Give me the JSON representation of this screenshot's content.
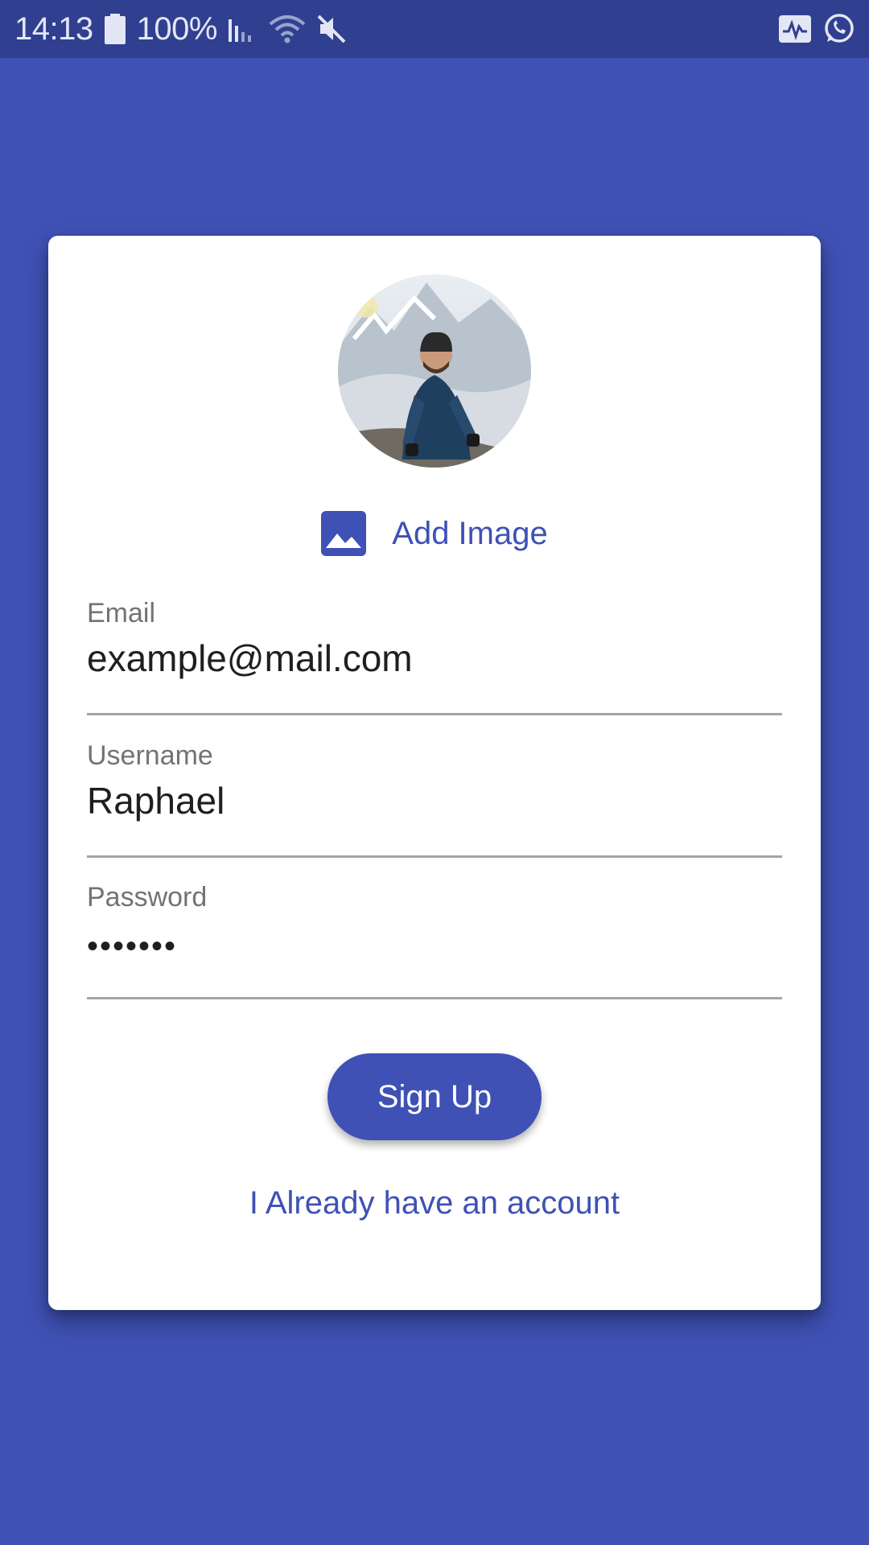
{
  "status_bar": {
    "time": "14:13",
    "battery_percent": "100%",
    "icons": [
      "battery-icon",
      "signal-icon",
      "wifi-icon",
      "mute-icon",
      "activity-app-icon",
      "whatsapp-icon"
    ]
  },
  "colors": {
    "primary": "#3f51b5",
    "status_bar": "#303f8f",
    "card": "#ffffff"
  },
  "profile": {
    "avatar": "profile-photo",
    "add_image_label": "Add Image",
    "add_image_icon": "image-icon"
  },
  "form": {
    "email": {
      "label": "Email",
      "value": "example@mail.com"
    },
    "username": {
      "label": "Username",
      "value": "Raphael"
    },
    "password": {
      "label": "Password",
      "value": "•••••••"
    }
  },
  "actions": {
    "signup_label": "Sign Up",
    "login_link": "I Already have an account"
  }
}
